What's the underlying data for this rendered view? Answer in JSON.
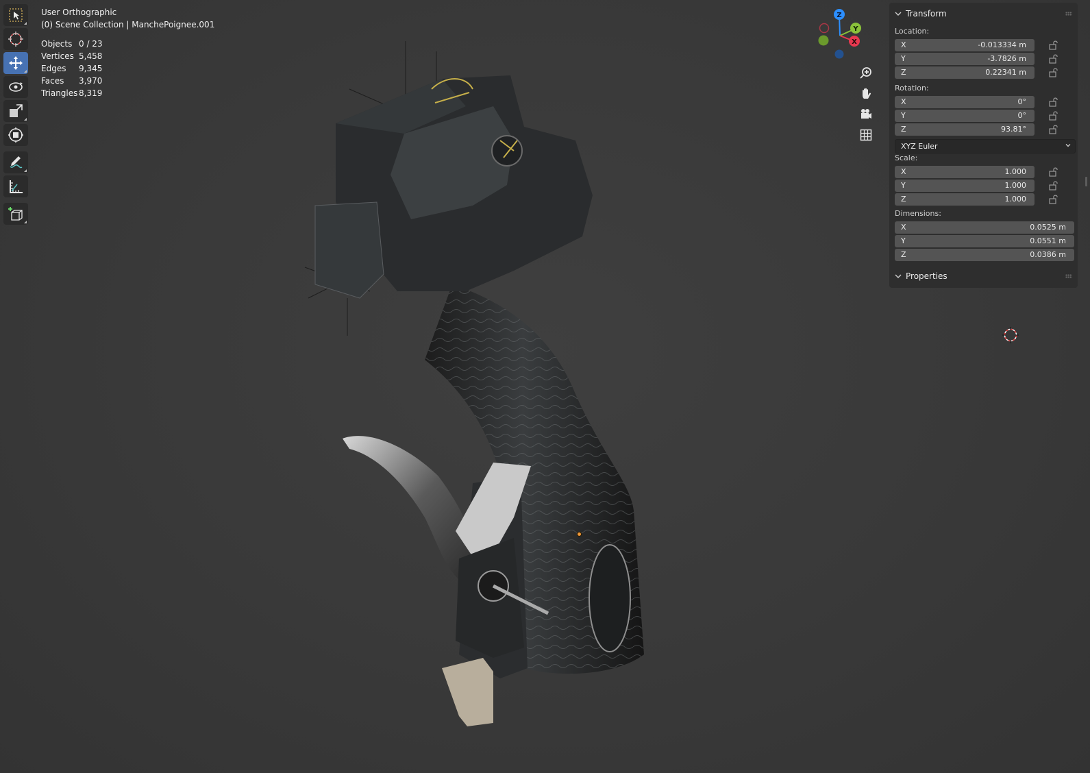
{
  "viewport": {
    "view_name": "User Orthographic",
    "collection_line": "(0) Scene Collection | ManchePoignee.001"
  },
  "stats": [
    {
      "label": "Objects",
      "value": "0 / 23"
    },
    {
      "label": "Vertices",
      "value": "5,458"
    },
    {
      "label": "Edges",
      "value": "9,345"
    },
    {
      "label": "Faces",
      "value": "3,970"
    },
    {
      "label": "Triangles",
      "value": "8,319"
    }
  ],
  "toolbar": {
    "tools": [
      "select-box-icon",
      "cursor-icon",
      "move-icon",
      "rotate-icon",
      "scale-icon",
      "transform-icon",
      "annotate-icon",
      "measure-icon",
      "add-cube-icon"
    ],
    "active_tool": "move-icon"
  },
  "gizmo": {
    "x": "X",
    "y": "Y",
    "z": "Z"
  },
  "nav_buttons": [
    "zoom-icon",
    "pan-hand-icon",
    "camera-icon",
    "grid-icon"
  ],
  "transform_panel": {
    "title": "Transform",
    "location_label": "Location:",
    "location": [
      {
        "axis": "X",
        "value": "-0.013334 m"
      },
      {
        "axis": "Y",
        "value": "-3.7826 m"
      },
      {
        "axis": "Z",
        "value": "0.22341 m"
      }
    ],
    "rotation_label": "Rotation:",
    "rotation": [
      {
        "axis": "X",
        "value": "0°"
      },
      {
        "axis": "Y",
        "value": "0°"
      },
      {
        "axis": "Z",
        "value": "93.81°"
      }
    ],
    "rotation_mode": "XYZ Euler",
    "scale_label": "Scale:",
    "scale": [
      {
        "axis": "X",
        "value": "1.000"
      },
      {
        "axis": "Y",
        "value": "1.000"
      },
      {
        "axis": "Z",
        "value": "1.000"
      }
    ],
    "dimensions_label": "Dimensions:",
    "dimensions": [
      {
        "axis": "X",
        "value": "0.0525 m"
      },
      {
        "axis": "Y",
        "value": "0.0551 m"
      },
      {
        "axis": "Z",
        "value": "0.0386 m"
      }
    ]
  },
  "properties_panel": {
    "title": "Properties"
  },
  "colors": {
    "active_tool": "#4772b3",
    "axis_x": "#e8384f",
    "axis_y": "#8ac13a",
    "axis_z": "#2c8fff",
    "panel_bg": "#2e2e2e",
    "field_bg": "#545454",
    "viewport_bg": "#393939"
  }
}
